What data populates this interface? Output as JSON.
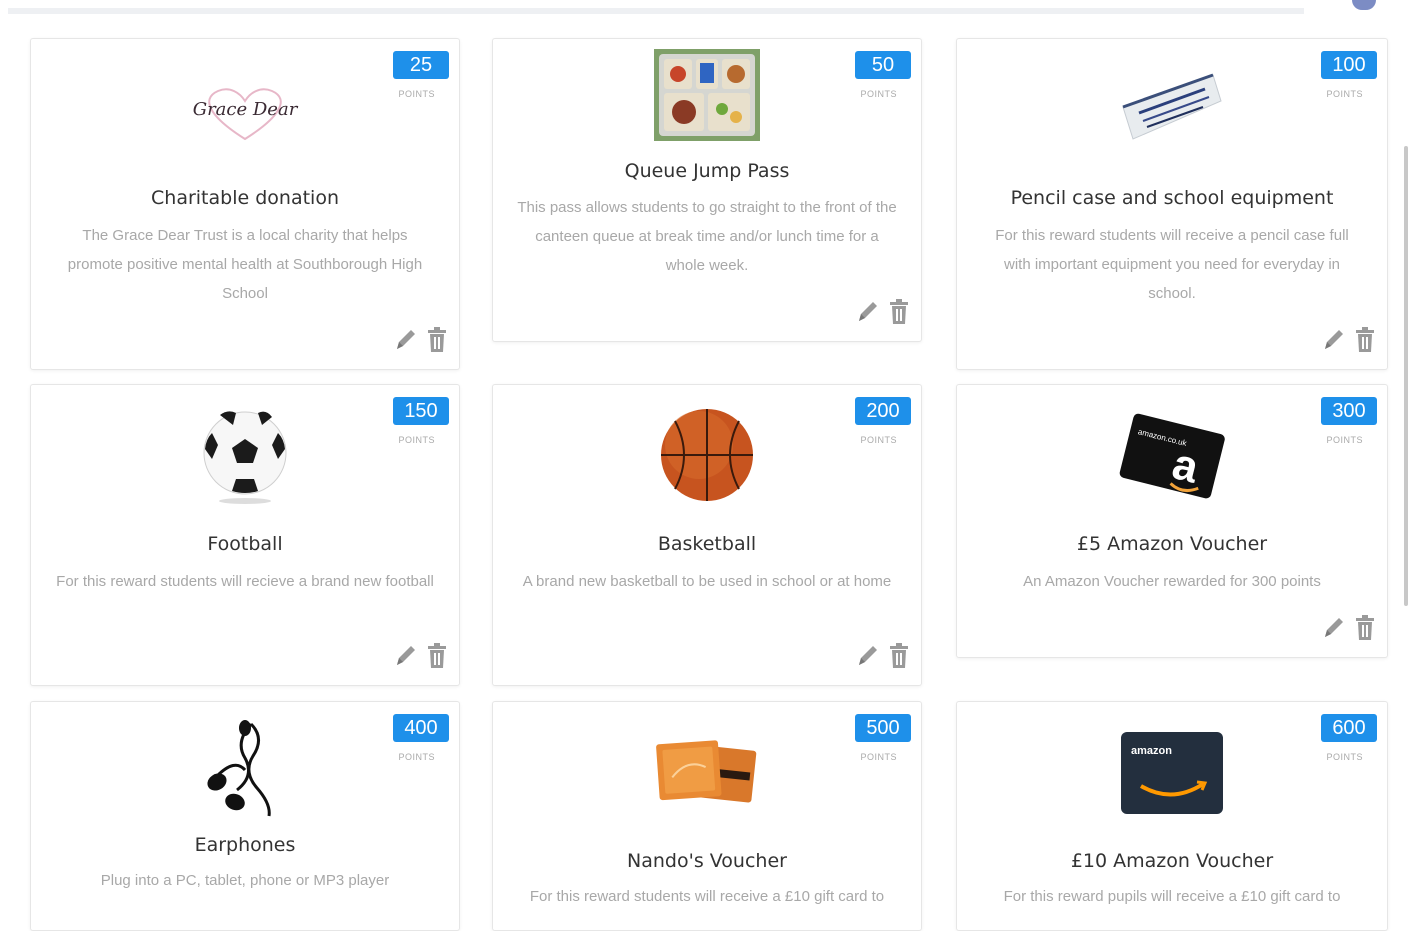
{
  "points_label": "POINTS",
  "rewards": [
    {
      "points": "25",
      "title": "Charitable donation",
      "description": "The Grace Dear Trust is a local charity that helps promote positive mental health at Southborough High School",
      "logo_text": "Grace Dear"
    },
    {
      "points": "50",
      "title": "Queue Jump Pass",
      "description": "This pass allows students to go straight to the front of the canteen queue at break time and/or lunch time for a whole week."
    },
    {
      "points": "100",
      "title": "Pencil case and school equipment",
      "description": "For this reward students will receive a pencil case full with important equipment you need for everyday in school."
    },
    {
      "points": "150",
      "title": "Football",
      "description": "For this reward students will recieve a brand new football"
    },
    {
      "points": "200",
      "title": "Basketball",
      "description": "A brand new basketball to be used in school or at home"
    },
    {
      "points": "300",
      "title": "£5 Amazon Voucher",
      "description": "An Amazon Voucher rewarded for 300 points",
      "logo_text": "amazon.co.uk"
    },
    {
      "points": "400",
      "title": "Earphones",
      "description": "Plug into a PC, tablet, phone or MP3 player"
    },
    {
      "points": "500",
      "title": "Nando's Voucher",
      "description": "For this reward students will receive a £10 gift card to"
    },
    {
      "points": "600",
      "title": "£10 Amazon Voucher",
      "description": "For this reward pupils will receive a £10 gift card to",
      "logo_text": "amazon"
    }
  ],
  "icons": {
    "edit": "pencil-icon",
    "delete": "trash-icon"
  },
  "colors": {
    "badge": "#1e90ea",
    "title": "#333333",
    "description": "#a8a8a8",
    "icon": "#9a9a9a"
  }
}
